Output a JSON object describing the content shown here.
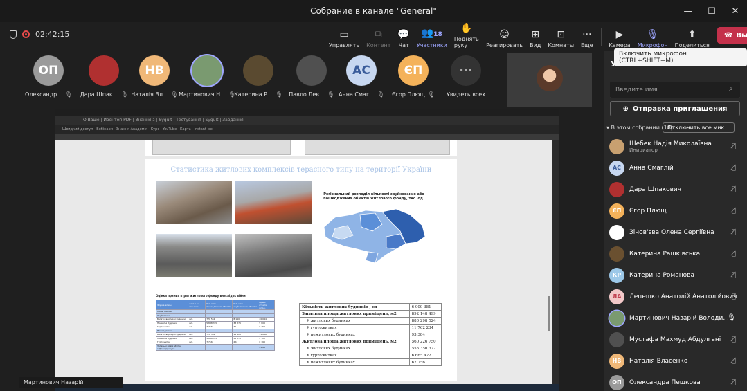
{
  "window": {
    "title": "Собрание в канале \"General\"",
    "minimize": "—",
    "maximize": "☐",
    "close": "✕"
  },
  "meeting": {
    "timer": "02:42:15"
  },
  "toolbar": {
    "buttons": [
      {
        "label": "Управлять",
        "icon": "▭"
      },
      {
        "label": "Контент",
        "icon": "⧉"
      },
      {
        "label": "Чат",
        "icon": "💬"
      },
      {
        "label": "Участники",
        "icon": "👥",
        "count": "18"
      },
      {
        "label": "Поднять руку",
        "icon": "✋"
      },
      {
        "label": "Реагировать",
        "icon": "☺"
      },
      {
        "label": "Вид",
        "icon": "⊞"
      },
      {
        "label": "Комнаты",
        "icon": "⊡"
      },
      {
        "label": "Еще",
        "icon": "···"
      },
      {
        "label": "Камера",
        "icon": "▶"
      },
      {
        "label": "Микрофон",
        "icon": "🎙"
      },
      {
        "label": "Поделиться",
        "icon": "⬆"
      }
    ],
    "leave_label": "Выйти",
    "leave_icon": "☎",
    "leave_chevron": "⌄"
  },
  "tooltip": "Включить микрофон (CTRL+SHIFT+M)",
  "strip": [
    {
      "initials": "ОП",
      "name": "Олександр...",
      "bg": "#9a9a9a",
      "fg": "#fff"
    },
    {
      "initials": "",
      "name": "Дара Шпак...",
      "bg": "#b03030",
      "fg": "#fff"
    },
    {
      "initials": "НВ",
      "name": "Наталія Вл...",
      "bg": "#f0b878",
      "fg": "#fff"
    },
    {
      "initials": "",
      "name": "Мартинович Н...",
      "bg": "#7a9a70",
      "fg": "#fff"
    },
    {
      "initials": "",
      "name": "Катерина Р...",
      "bg": "#5a4a30",
      "fg": "#fff"
    },
    {
      "initials": "",
      "name": "Павло Лев...",
      "bg": "#505050",
      "fg": "#fff"
    },
    {
      "initials": "АС",
      "name": "Анна Смаг...",
      "bg": "#c7d7f0",
      "fg": "#3a5c9a"
    },
    {
      "initials": "ЄП",
      "name": "Єгор Плющ",
      "bg": "#f4b25a",
      "fg": "#fff"
    },
    {
      "initials": "···",
      "name": "Увидеть всех",
      "bg": "#333",
      "fg": "#aaa"
    }
  ],
  "shared": {
    "tabs_row": "O Ваше | Ивентоп PDF | Знання з | Sygult | Тестування | Sygult | Завдання",
    "bookmarks": "Швидкий доступ  ·  Вебінари  ·  Знання-Академія  ·  Курс  ·  YouTube  ·  Карта  ·  Instant Ice",
    "pdf_title": "Статистика житлових комплексів терасного типу на території України",
    "map_title": "Регіональний розподіл кількості зруйнованих або пошкоджених об'єктів житлового фонду, тис. од.",
    "t1_caption": "Оцінка прямих втрат житлового фонду внаслідок війни",
    "t1_headers": [
      "Форма власн.",
      "Загальна кількість",
      "Кількість пошкоджених об'єктів",
      "Кількість зруйнованих об'єктів",
      "Прямі втрати млрд."
    ],
    "t1_rows": [
      [
        "Прямі збитки",
        "",
        "",
        "",
        ""
      ],
      [
        "Зруйновано",
        "",
        "",
        "",
        ""
      ],
      [
        "Багатоквартирні будинки",
        "шт.",
        "770 561",
        "8 190",
        "20 044"
      ],
      [
        "Приватні будинки",
        "шт.",
        "5 888 370",
        "38 376",
        "5 800"
      ],
      [
        "Гуртожитки",
        "шт.",
        "7 716",
        "75",
        "0 150"
      ],
      [
        "Пошкоджено",
        "",
        "",
        "",
        ""
      ],
      [
        "Багатоквартирні будинки",
        "шт.",
        "770 561",
        "11 926",
        "15 016"
      ],
      [
        "Приватні будинки",
        "шт.",
        "5 888 370",
        "38 376",
        "2 722"
      ],
      [
        "Гуртожитки",
        "шт.",
        "7 716",
        "222",
        "0 160"
      ],
      [
        "Загальні прямі збитки інфраструктури",
        "",
        "",
        "",
        "25,83"
      ]
    ],
    "t2_rows": [
      {
        "label": "Кількість житлових будинків , од",
        "value": "6 009 381",
        "style": "b"
      },
      {
        "label": "Загальна площа житлових приміщень, м2",
        "value": "892 148 499",
        "style": "b"
      },
      {
        "label": "У житлових будинках",
        "value": "880 298 524",
        "style": "ind"
      },
      {
        "label": "У гуртожитках",
        "value": "11 762 234",
        "style": "ind"
      },
      {
        "label": "У нежитлових будинках",
        "value": "93 384",
        "style": "ind"
      },
      {
        "label": "Житлова площа житлових приміщень, м2",
        "value": "560 226 750",
        "style": "b"
      },
      {
        "label": "У житлових будинках",
        "value": "553 350 372",
        "style": "ind"
      },
      {
        "label": "У гуртожитках",
        "value": "6 665 422",
        "style": "ind"
      },
      {
        "label": "У нежитлових будинках",
        "value": "62 756",
        "style": "ind"
      }
    ]
  },
  "speaker_label": "Мартинович Назарій Володимирович",
  "panel": {
    "title": "Участники",
    "close_icon": "✕",
    "search_placeholder": "Введите имя",
    "search_icon": "⌕",
    "invite_icon": "⊕",
    "invite_label": "Отправка приглашения",
    "section_label": "▾ В этом собрании (18)",
    "mute_all": "Отключить все мик...",
    "participants": [
      {
        "initials": "",
        "name": "Шебек Надія Миколаївна",
        "role": "Инициатор",
        "bg": "#c8a070",
        "fg": "#fff",
        "mic": "🎙̸"
      },
      {
        "initials": "АС",
        "name": "Анна Смаглій",
        "role": "",
        "bg": "#c7d7f0",
        "fg": "#3a5c9a",
        "mic": "🎙̸"
      },
      {
        "initials": "",
        "name": "Дара Шпакович",
        "role": "",
        "bg": "#b03030",
        "fg": "#fff",
        "mic": "🎙̸"
      },
      {
        "initials": "ЄП",
        "name": "Єгор Плющ",
        "role": "",
        "bg": "#f4b25a",
        "fg": "#fff",
        "mic": "🎙̸"
      },
      {
        "initials": "",
        "name": "Зінов'єва Олена Сергіївна",
        "role": "",
        "bg": "#ffffff",
        "fg": "#fff",
        "mic": "🎙̸"
      },
      {
        "initials": "",
        "name": "Катерина Рашківська",
        "role": "",
        "bg": "#6a5030",
        "fg": "#fff",
        "mic": "🎙̸"
      },
      {
        "initials": "КР",
        "name": "Катерина Романова",
        "role": "",
        "bg": "#9cc8e8",
        "fg": "#fff",
        "mic": "🎙̸"
      },
      {
        "initials": "ЛА",
        "name": "Лепешко Анатолій Анатолійович",
        "role": "",
        "bg": "#f2c8c8",
        "fg": "#c04050",
        "mic": "🎙̸"
      },
      {
        "initials": "",
        "name": "Мартинович Назарій Володи...",
        "role": "",
        "bg": "#7a9a70",
        "fg": "#fff",
        "mic": "🎙"
      },
      {
        "initials": "",
        "name": "Мустафа Махмуд Абдулгані",
        "role": "",
        "bg": "#505050",
        "fg": "#fff",
        "mic": "🎙̸"
      },
      {
        "initials": "НВ",
        "name": "Наталія Власенко",
        "role": "",
        "bg": "#f0b878",
        "fg": "#fff",
        "mic": "🎙̸"
      },
      {
        "initials": "ОП",
        "name": "Олександра Пешкова",
        "role": "",
        "bg": "#9a9a9a",
        "fg": "#fff",
        "mic": "🎙̸"
      }
    ]
  }
}
